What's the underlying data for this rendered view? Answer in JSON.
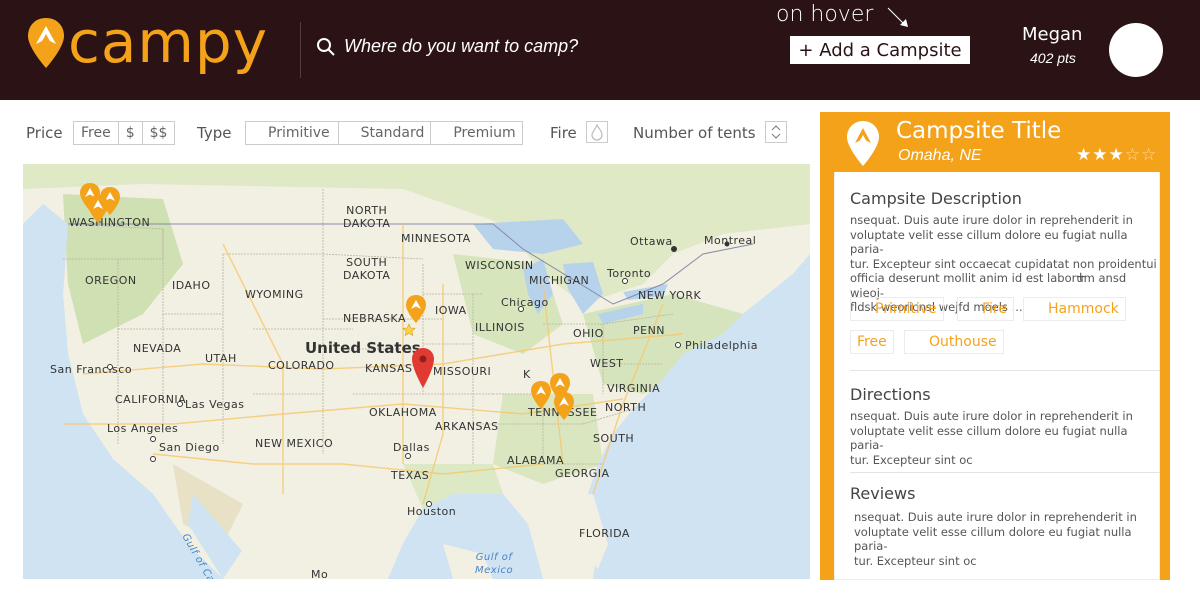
{
  "header": {
    "logo_text": "campy",
    "search_placeholder": "Where do you want to camp?",
    "hover_note": "on hover",
    "add_button": "+ Add a Campsite",
    "user_name": "Megan",
    "user_points": "402 pts"
  },
  "filters": {
    "price_label": "Price",
    "price_options": [
      "Free",
      "$",
      "$$"
    ],
    "type_label": "Type",
    "type_options": [
      "Primitive",
      "Standard",
      "Premium"
    ],
    "fire_label": "Fire",
    "tents_label": "Number of tents"
  },
  "map": {
    "labels": {
      "washington": "WASHINGTON",
      "oregon": "OREGON",
      "idaho": "IDAHO",
      "wyoming": "WYOMING",
      "nevada": "NEVADA",
      "utah": "UTAH",
      "colorado": "COLORADO",
      "california": "CALIFORNIA",
      "north_dakota": "NORTH\nDAKOTA",
      "south_dakota": "SOUTH\nDAKOTA",
      "nebraska": "NEBRASKA",
      "kansas": "KANSAS",
      "oklahoma": "OKLAHOMA",
      "texas": "TEXAS",
      "new_mexico": "NEW MEXICO",
      "minnesota": "MINNESOTA",
      "iowa": "IOWA",
      "missouri": "MISSOURI",
      "arkansas": "ARKANSAS",
      "wisconsin": "WISCONSIN",
      "michigan": "MICHIGAN",
      "illinois": "ILLINOIS",
      "ohio": "OHIO",
      "penn": "PENN",
      "new_york": "NEW YORK",
      "west_virginia": "WEST",
      "virginia": "VIRGINIA",
      "north_carolina": "NORTH",
      "tennessee": "TENNESSEE",
      "south_carolina": "SOUTH",
      "georgia": "GEORGIA",
      "alabama": "ALABAMA",
      "florida": "FLORIDA",
      "kentucky": "K",
      "united_states": "United States",
      "san_francisco": "San Francisco",
      "las_vegas": "Las Vegas",
      "los_angeles": "Los Angeles",
      "san_diego": "San Diego",
      "dallas": "Dallas",
      "houston": "Houston",
      "chicago": "Chicago",
      "toronto": "Toronto",
      "ottawa": "Ottawa",
      "montreal": "Montreal",
      "philadelphia": "Philadelphia",
      "gulf_mexico": "Gulf of\nMexico",
      "gulf_california": "Gulf of California",
      "mo": "Mo"
    }
  },
  "panel": {
    "title": "Campsite Title",
    "location": "Omaha, NE",
    "rating": 3,
    "rating_max": 5,
    "stars_filled": "★★★",
    "stars_empty": "☆☆",
    "description_title": "Campsite Description",
    "description_lines": [
      "nsequat. Duis aute irure dolor in reprehenderit in",
      "voluptate velit esse cillum dolore eu fugiat nulla paria-",
      "tur. Excepteur sint occaecat cupidatat non proidentui",
      "officia deserunt mollit anim id est laborum ansd wieoj-",
      "fldsk weoricnsl wejfd moels ..."
    ],
    "plus": "+",
    "tags": [
      "Primitive",
      "Fire",
      "Hammock",
      "Free",
      "Outhouse"
    ],
    "directions_title": "Directions",
    "directions_lines": [
      "nsequat. Duis aute irure dolor in reprehenderit in",
      "voluptate velit esse cillum dolore eu fugiat nulla paria-",
      "tur. Excepteur sint oc"
    ],
    "reviews_title": "Reviews",
    "reviews_lines": [
      "nsequat. Duis aute irure dolor in reprehenderit in",
      "voluptate velit esse cillum dolore eu fugiat nulla paria-",
      "tur. Excepteur sint oc"
    ]
  },
  "colors": {
    "header_bg": "#2b1315",
    "accent": "#f5a21b",
    "map_red_pin": "#e03a32"
  },
  "icons": [
    "search-icon",
    "logo-pin-icon",
    "fire-icon",
    "stepper-icon",
    "campsite-pin-icon",
    "star-icon",
    "map-marker-icon",
    "tag-icon"
  ]
}
